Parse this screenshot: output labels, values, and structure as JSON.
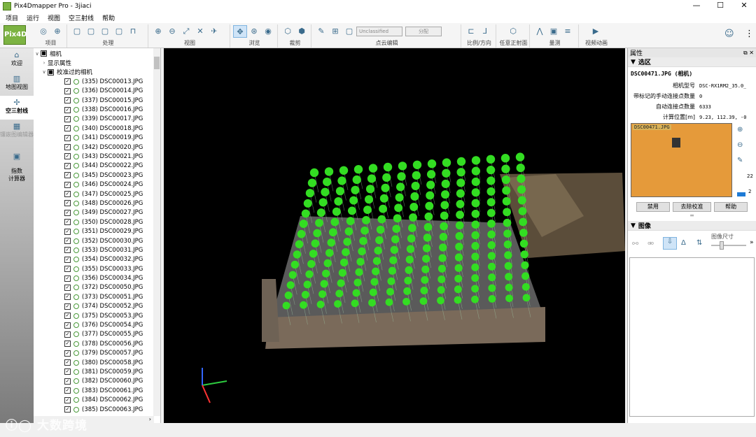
{
  "window": {
    "title": "Pix4Dmapper Pro - 3jiaci",
    "min": "—",
    "max": "☐",
    "close": "✕"
  },
  "menu": [
    "项目",
    "运行",
    "视图",
    "空三射线",
    "帮助"
  ],
  "toolbar": {
    "logo": "Pix4D",
    "groups": [
      "项目",
      "处理",
      "视图",
      "浏览",
      "裁剪",
      "点云编辑",
      "比例/方向",
      "任意正射面",
      "量测",
      "视频动画"
    ],
    "class_select": "Unclassified",
    "assign_button": "分配"
  },
  "leftnav": [
    {
      "label": "欢迎",
      "icon": "⌂"
    },
    {
      "label": "地图视图",
      "icon": "▥"
    },
    {
      "label": "空三射线",
      "icon": "✢"
    },
    {
      "label": "镶嵌图编辑器",
      "icon": "▦"
    },
    {
      "label": "指数\n计算器",
      "icon": "▣"
    }
  ],
  "tree": {
    "root": "相机",
    "props_node": "显示属性",
    "calibrated_node": "校准过的相机",
    "images": [
      "(335) DSC00013.JPG",
      "(336) DSC00014.JPG",
      "(337) DSC00015.JPG",
      "(338) DSC00016.JPG",
      "(339) DSC00017.JPG",
      "(340) DSC00018.JPG",
      "(341) DSC00019.JPG",
      "(342) DSC00020.JPG",
      "(343) DSC00021.JPG",
      "(344) DSC00022.JPG",
      "(345) DSC00023.JPG",
      "(346) DSC00024.JPG",
      "(347) DSC00025.JPG",
      "(348) DSC00026.JPG",
      "(349) DSC00027.JPG",
      "(350) DSC00028.JPG",
      "(351) DSC00029.JPG",
      "(352) DSC00030.JPG",
      "(353) DSC00031.JPG",
      "(354) DSC00032.JPG",
      "(355) DSC00033.JPG",
      "(356) DSC00034.JPG",
      "(372) DSC00050.JPG",
      "(373) DSC00051.JPG",
      "(374) DSC00052.JPG",
      "(375) DSC00053.JPG",
      "(376) DSC00054.JPG",
      "(377) DSC00055.JPG",
      "(378) DSC00056.JPG",
      "(379) DSC00057.JPG",
      "(380) DSC00058.JPG",
      "(381) DSC00059.JPG",
      "(382) DSC00060.JPG",
      "(383) DSC00061.JPG",
      "(384) DSC00062.JPG",
      "(385) DSC00063.JPG"
    ]
  },
  "properties": {
    "panel_title": "属性",
    "section": "选区",
    "filename": "DSC00471.JPG (相机)",
    "rows": [
      {
        "k": "相机型号",
        "v": "DSC-RX1RM2_35.0_"
      },
      {
        "k": "带标记的手动连接点数量",
        "v": "0"
      },
      {
        "k": "自动连接点数量",
        "v": "6333"
      },
      {
        "k": "计算位置[m]",
        "v": "9.23, 112.39, -0"
      }
    ],
    "thumb_caption": "DSC00471.JPG",
    "zoom_values": [
      "22",
      "2"
    ],
    "buttons": [
      "禁用",
      "去除校准",
      "帮助"
    ],
    "image_section": "图像",
    "image_size_label": "图像尺寸"
  },
  "watermark": "大数跨境",
  "colors": {
    "camera_ball": "#33dd22",
    "accent": "#3a6b8c",
    "viewport": "#000000"
  }
}
